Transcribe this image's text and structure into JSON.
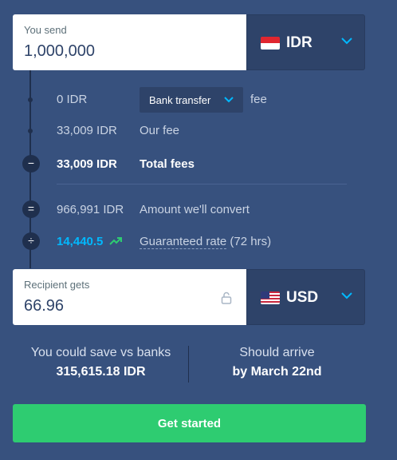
{
  "colors": {
    "background": "#37517e",
    "accent": "#2ecc71",
    "rate": "#00b9ff",
    "panel": "#2e4369"
  },
  "send": {
    "label": "You send",
    "value": "1,000,000",
    "currency": "IDR",
    "flag": "indonesia-flag-icon"
  },
  "breakdown": {
    "transfer_fee": {
      "amount": "0 IDR",
      "method": "Bank transfer",
      "suffix": "fee"
    },
    "our_fee": {
      "amount": "33,009 IDR",
      "label": "Our fee"
    },
    "total_fees": {
      "symbol": "−",
      "amount": "33,009 IDR",
      "label": "Total fees"
    },
    "convert": {
      "symbol": "=",
      "amount": "966,991 IDR",
      "label": "Amount we'll convert"
    },
    "rate": {
      "symbol": "÷",
      "value": "14,440.5",
      "trend_icon": "trend-up-icon",
      "label": "Guaranteed rate",
      "suffix": "(72 hrs)"
    }
  },
  "receive": {
    "label": "Recipient gets",
    "value": "66.96",
    "lock_icon": "unlock-icon",
    "currency": "USD",
    "flag": "us-flag-icon"
  },
  "summary": {
    "save_label": "You could save vs banks",
    "save_value": "315,615.18 IDR",
    "arrive_label": "Should arrive",
    "arrive_value": "by March 22nd"
  },
  "cta": {
    "label": "Get started"
  }
}
